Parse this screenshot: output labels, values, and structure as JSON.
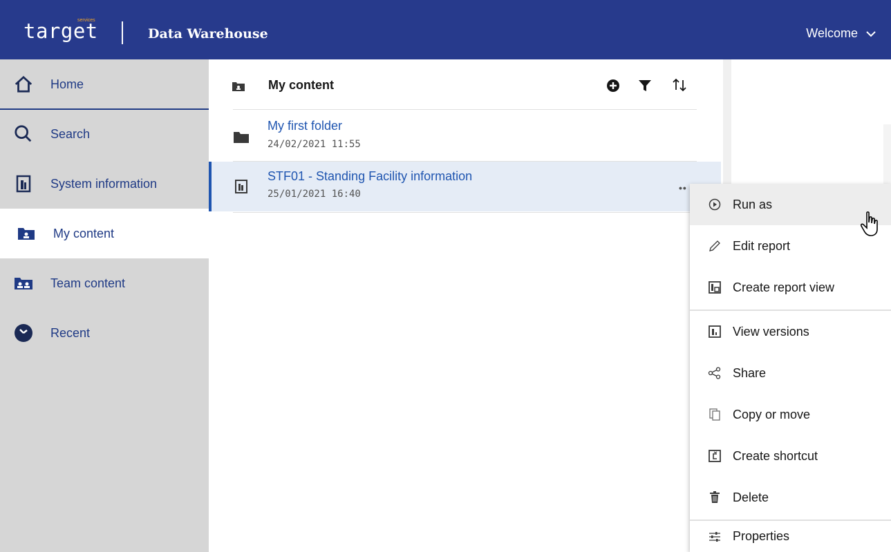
{
  "header": {
    "logo_text": "target",
    "logo_sub": "services",
    "app_title": "Data Warehouse",
    "welcome_label": "Welcome"
  },
  "sidebar": {
    "items": [
      {
        "label": "Home",
        "icon": "home-icon"
      },
      {
        "label": "Search",
        "icon": "search-icon"
      },
      {
        "label": "System information",
        "icon": "report-icon"
      },
      {
        "label": "My content",
        "icon": "my-folder-icon",
        "active": true
      },
      {
        "label": "Team content",
        "icon": "team-folder-icon"
      },
      {
        "label": "Recent",
        "icon": "clock-icon"
      }
    ]
  },
  "content": {
    "title": "My content",
    "toolbar_icons": [
      "add-icon",
      "filter-icon",
      "sort-icon"
    ],
    "rows": [
      {
        "name": "My first folder",
        "date": "24/02/2021 11:55",
        "icon": "folder-icon"
      },
      {
        "name": "STF01 - Standing Facility information",
        "date": "25/01/2021 16:40",
        "icon": "report-icon",
        "selected": true
      }
    ],
    "more_label": "••"
  },
  "context_menu": {
    "items": [
      {
        "label": "Run as",
        "icon": "play-icon"
      },
      {
        "label": "Edit report",
        "icon": "pencil-icon"
      },
      {
        "label": "Create report view",
        "icon": "report-view-icon"
      },
      {
        "label": "View versions",
        "icon": "versions-icon"
      },
      {
        "label": "Share",
        "icon": "share-icon"
      },
      {
        "label": "Copy or move",
        "icon": "copy-icon"
      },
      {
        "label": "Create shortcut",
        "icon": "shortcut-icon"
      },
      {
        "label": "Delete",
        "icon": "trash-icon"
      },
      {
        "label": "Properties",
        "icon": "sliders-icon"
      }
    ]
  },
  "colors": {
    "header_bg": "#273a8c",
    "sidebar_bg": "#d6d6d6",
    "link_blue": "#1f55b0",
    "selected_row_bg": "#e5ecf6"
  }
}
